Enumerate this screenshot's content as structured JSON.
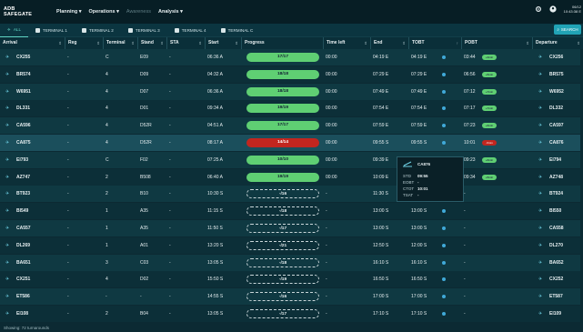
{
  "brand": {
    "line1": "ADB",
    "line2": "SAFEGATE"
  },
  "nav": {
    "planning": "Planning",
    "operations": "Operations",
    "awareness": "Awareness",
    "analysis": "Analysis"
  },
  "clock": {
    "date": "06/12",
    "time": "10:43:38 E"
  },
  "tabs": [
    "ALL",
    "TERMINAL 1",
    "TERMINAL 2",
    "TERMINAL 3",
    "TERMINAL 4",
    "TERMINAL C"
  ],
  "search_label": "SEARCH",
  "columns": [
    "Arrival",
    "Reg",
    "Terminal",
    "Stand",
    "STA",
    "Start",
    "Progress",
    "Time left",
    "End",
    "TOBT",
    "POBT",
    "Departure"
  ],
  "rows": [
    {
      "arr": "CX255",
      "reg": "-",
      "term": "C",
      "stand": "E09",
      "sta": "-",
      "start": "06:36 A",
      "progress": "17/17",
      "timeleft": "00:00",
      "end": "04:19 E",
      "tobt": "04:19 E",
      "pobt": "03:44",
      "badge": "+3min",
      "dep": "CX256",
      "status": "done"
    },
    {
      "arr": "BR574",
      "reg": "-",
      "term": "4",
      "stand": "D09",
      "sta": "-",
      "start": "04:32 A",
      "progress": "18/18",
      "timeleft": "00:00",
      "end": "07:29 E",
      "tobt": "07:29 E",
      "pobt": "06:56",
      "badge": "+5min",
      "dep": "BR575",
      "status": "done"
    },
    {
      "arr": "W6951",
      "reg": "-",
      "term": "4",
      "stand": "D07",
      "sta": "-",
      "start": "06:36 A",
      "progress": "18/18",
      "timeleft": "00:00",
      "end": "07:49 E",
      "tobt": "07:49 E",
      "pobt": "07:12",
      "badge": "+7min",
      "dep": "W6952",
      "status": "done"
    },
    {
      "arr": "DL331",
      "reg": "-",
      "term": "4",
      "stand": "D01",
      "sta": "-",
      "start": "09:34 A",
      "progress": "19/19",
      "timeleft": "00:00",
      "end": "07:54 E",
      "tobt": "07:54 E",
      "pobt": "07:17",
      "badge": "+7min",
      "dep": "DL332",
      "status": "done"
    },
    {
      "arr": "CA596",
      "reg": "-",
      "term": "4",
      "stand": "D52R",
      "sta": "-",
      "start": "04:51 A",
      "progress": "17/17",
      "timeleft": "00:00",
      "end": "07:59 E",
      "tobt": "07:59 E",
      "pobt": "07:23",
      "badge": "+6min",
      "dep": "CA597",
      "status": "done"
    },
    {
      "arr": "CA875",
      "reg": "-",
      "term": "4",
      "stand": "D52R",
      "sta": "-",
      "start": "08:17 A",
      "progress": "14/14",
      "timeleft": "00:00",
      "end": "09:55 S",
      "tobt": "09:55 S",
      "pobt": "10:01",
      "badge": "-6min",
      "dep": "CA876",
      "status": "late"
    },
    {
      "arr": "EI793",
      "reg": "-",
      "term": "C",
      "stand": "F02",
      "sta": "-",
      "start": "07:25 A",
      "progress": "10/10",
      "timeleft": "00:00",
      "end": "09:39 E",
      "tobt": "09:39 E",
      "pobt": "09:23",
      "badge": "+6min",
      "dep": "EI794",
      "status": "done"
    },
    {
      "arr": "AZ747",
      "reg": "-",
      "term": "2",
      "stand": "B508",
      "sta": "-",
      "start": "06:40 A",
      "progress": "19/19",
      "timeleft": "00:00",
      "end": "10:09 E",
      "tobt": "10:09 E",
      "pobt": "09:34",
      "badge": "+5min",
      "dep": "AZ748",
      "status": "done"
    },
    {
      "arr": "BT923",
      "reg": "-",
      "term": "2",
      "stand": "B10",
      "sta": "-",
      "start": "10:30 S",
      "progress": "-/16",
      "timeleft": "-",
      "end": "11:30 S",
      "tobt": "11:30 S",
      "pobt": "-",
      "badge": "",
      "dep": "BT924",
      "status": "pending"
    },
    {
      "arr": "BI549",
      "reg": "-",
      "term": "1",
      "stand": "A35",
      "sta": "-",
      "start": "11:15 S",
      "progress": "-/18",
      "timeleft": "-",
      "end": "13:00 S",
      "tobt": "13:00 S",
      "pobt": "-",
      "badge": "",
      "dep": "BI550",
      "status": "pending"
    },
    {
      "arr": "CA557",
      "reg": "-",
      "term": "1",
      "stand": "A35",
      "sta": "-",
      "start": "11:50 S",
      "progress": "-/17",
      "timeleft": "-",
      "end": "13:00 S",
      "tobt": "13:00 S",
      "pobt": "-",
      "badge": "",
      "dep": "CA558",
      "status": "pending"
    },
    {
      "arr": "DL269",
      "reg": "-",
      "term": "1",
      "stand": "A01",
      "sta": "-",
      "start": "13:20 S",
      "progress": "-/21",
      "timeleft": "-",
      "end": "12:50 S",
      "tobt": "12:00 S",
      "pobt": "-",
      "badge": "",
      "dep": "DL270",
      "status": "pending"
    },
    {
      "arr": "BA651",
      "reg": "-",
      "term": "3",
      "stand": "C03",
      "sta": "-",
      "start": "13:05 S",
      "progress": "-/18",
      "timeleft": "-",
      "end": "16:10 S",
      "tobt": "16:10 S",
      "pobt": "-",
      "badge": "",
      "dep": "BA652",
      "status": "pending"
    },
    {
      "arr": "CX251",
      "reg": "-",
      "term": "4",
      "stand": "D02",
      "sta": "-",
      "start": "15:50 S",
      "progress": "-/19",
      "timeleft": "-",
      "end": "16:50 S",
      "tobt": "16:50 S",
      "pobt": "-",
      "badge": "",
      "dep": "CX252",
      "status": "pending"
    },
    {
      "arr": "ET586",
      "reg": "-",
      "term": "-",
      "stand": "-",
      "sta": "-",
      "start": "14:55 S",
      "progress": "-/16",
      "timeleft": "-",
      "end": "17:00 S",
      "tobt": "17:00 S",
      "pobt": "-",
      "badge": "",
      "dep": "ET587",
      "status": "pending"
    },
    {
      "arr": "EI108",
      "reg": "-",
      "term": "2",
      "stand": "B04",
      "sta": "-",
      "start": "13:05 S",
      "progress": "-/17",
      "timeleft": "-",
      "end": "17:10 S",
      "tobt": "17:10 S",
      "pobt": "-",
      "badge": "",
      "dep": "EI109",
      "status": "pending"
    }
  ],
  "tooltip": {
    "callsign": "CA876",
    "std_label": "STD",
    "std": "09:55",
    "eobt_label": "EOBT",
    "eobt": "-",
    "ctot_label": "CTOT",
    "ctot": "10:01",
    "tsat_label": "TSAT",
    "tsat": "-"
  },
  "footer": "Showing: 72 turnarounds"
}
